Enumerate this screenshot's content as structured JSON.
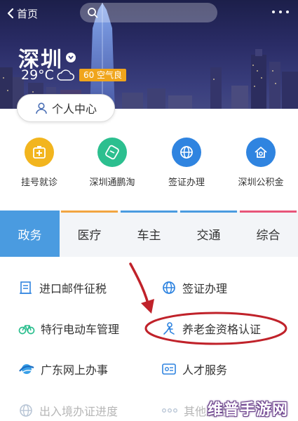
{
  "header": {
    "back_label": "首页",
    "city": "深圳",
    "temperature": "29°C",
    "air_quality": "60 空气良",
    "user_center_label": "个人中心"
  },
  "quick_services": [
    {
      "label": "挂号就诊",
      "icon": "hospital-icon",
      "color": "#f2b51e"
    },
    {
      "label": "深圳通鹏淘",
      "icon": "ticket-icon",
      "color": "#2cbf8f"
    },
    {
      "label": "签证办理",
      "icon": "globe-icon",
      "color": "#2f84e0"
    },
    {
      "label": "深圳公积金",
      "icon": "house-fund-icon",
      "color": "#2f84e0"
    }
  ],
  "tabs": [
    {
      "label": "政务",
      "color": "#4a9be0",
      "active": true
    },
    {
      "label": "医疗",
      "color": "#f2a541",
      "active": false
    },
    {
      "label": "车主",
      "color": "#4a9be0",
      "active": false
    },
    {
      "label": "交通",
      "color": "#4a9be0",
      "active": false
    },
    {
      "label": "综合",
      "color": "#e8557a",
      "active": false
    }
  ],
  "services": {
    "left": [
      {
        "label": "进口邮件征税",
        "icon": "mail-tax-icon"
      },
      {
        "label": "特行电动车管理",
        "icon": "bicycle-icon"
      },
      {
        "label": "广东网上办事",
        "icon": "gd-online-icon"
      },
      {
        "label": "出入境办证进度",
        "icon": "globe-icon"
      }
    ],
    "right": [
      {
        "label": "签证办理",
        "icon": "globe-icon"
      },
      {
        "label": "养老金资格认证",
        "icon": "pension-icon"
      },
      {
        "label": "人才服务",
        "icon": "id-card-icon"
      },
      {
        "label": "其他服务",
        "icon": "more-dots-icon"
      }
    ]
  },
  "colors": {
    "accent_blue": "#4a9be0",
    "annotation_red": "#c0222a",
    "aqi_badge": "#f0a51c"
  },
  "watermark": "维普手游网"
}
